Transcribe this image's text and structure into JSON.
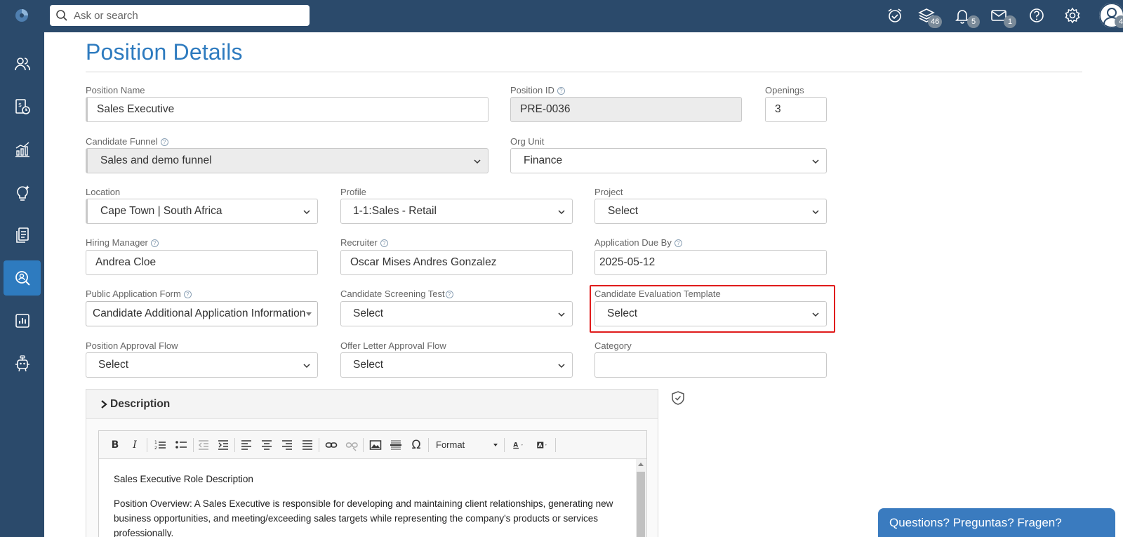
{
  "search": {
    "placeholder": "Ask or search"
  },
  "topbar": {
    "icons": [
      "alarm-clock-icon",
      "layers-icon",
      "bell-icon",
      "mail-icon",
      "help-circle-icon",
      "gear-icon",
      "user-avatar-icon"
    ],
    "badges": {
      "layers": "46",
      "notifications": "5",
      "mail": "1",
      "avatar": "4"
    }
  },
  "sidebar": {
    "items": [
      {
        "icon": "people-icon",
        "active": false
      },
      {
        "icon": "payroll-icon",
        "active": false
      },
      {
        "icon": "analytics-icon",
        "active": false
      },
      {
        "icon": "ideas-icon",
        "active": false
      },
      {
        "icon": "documents-icon",
        "active": false
      },
      {
        "icon": "recruitment-icon",
        "active": true
      },
      {
        "icon": "reports-icon",
        "active": false
      },
      {
        "icon": "bot-icon",
        "active": false
      }
    ]
  },
  "page": {
    "title": "Position Details"
  },
  "form": {
    "position_name": {
      "label": "Position Name",
      "value": "Sales Executive"
    },
    "position_id": {
      "label": "Position ID",
      "value": "PRE-0036"
    },
    "openings": {
      "label": "Openings",
      "value": "3"
    },
    "candidate_funnel": {
      "label": "Candidate Funnel",
      "value": "Sales and demo funnel"
    },
    "org_unit": {
      "label": "Org Unit",
      "value": "Finance"
    },
    "location": {
      "label": "Location",
      "value": "Cape Town | South Africa"
    },
    "profile": {
      "label": "Profile",
      "value": "1-1:Sales - Retail"
    },
    "project": {
      "label": "Project",
      "value": "Select"
    },
    "hiring_manager": {
      "label": "Hiring Manager",
      "value": "Andrea Cloe"
    },
    "recruiter": {
      "label": "Recruiter",
      "value": "Oscar Mises Andres Gonzalez"
    },
    "application_due_by": {
      "label": "Application Due By",
      "value": "2025-05-12"
    },
    "public_application_form": {
      "label": "Public Application Form",
      "value": "Candidate Additional Application Information"
    },
    "candidate_screening_test": {
      "label": "Candidate Screening Test",
      "value": "Select"
    },
    "candidate_evaluation_template": {
      "label": "Candidate Evaluation Template",
      "value": "Select"
    },
    "position_approval_flow": {
      "label": "Position Approval Flow",
      "value": "Select"
    },
    "offer_letter_approval_flow": {
      "label": "Offer Letter Approval Flow",
      "value": "Select"
    },
    "category": {
      "label": "Category",
      "value": ""
    }
  },
  "description": {
    "header": "Description",
    "toolbar": {
      "format_label": "Format"
    },
    "content": {
      "heading": "Sales Executive Role Description",
      "paragraph": "Position Overview: A Sales Executive is responsible for developing and maintaining client relationships, generating new business opportunities, and meeting/exceeding sales targets while representing the company's products or services professionally."
    }
  },
  "help_widget": {
    "label": "Questions? Preguntas? Fragen?"
  }
}
